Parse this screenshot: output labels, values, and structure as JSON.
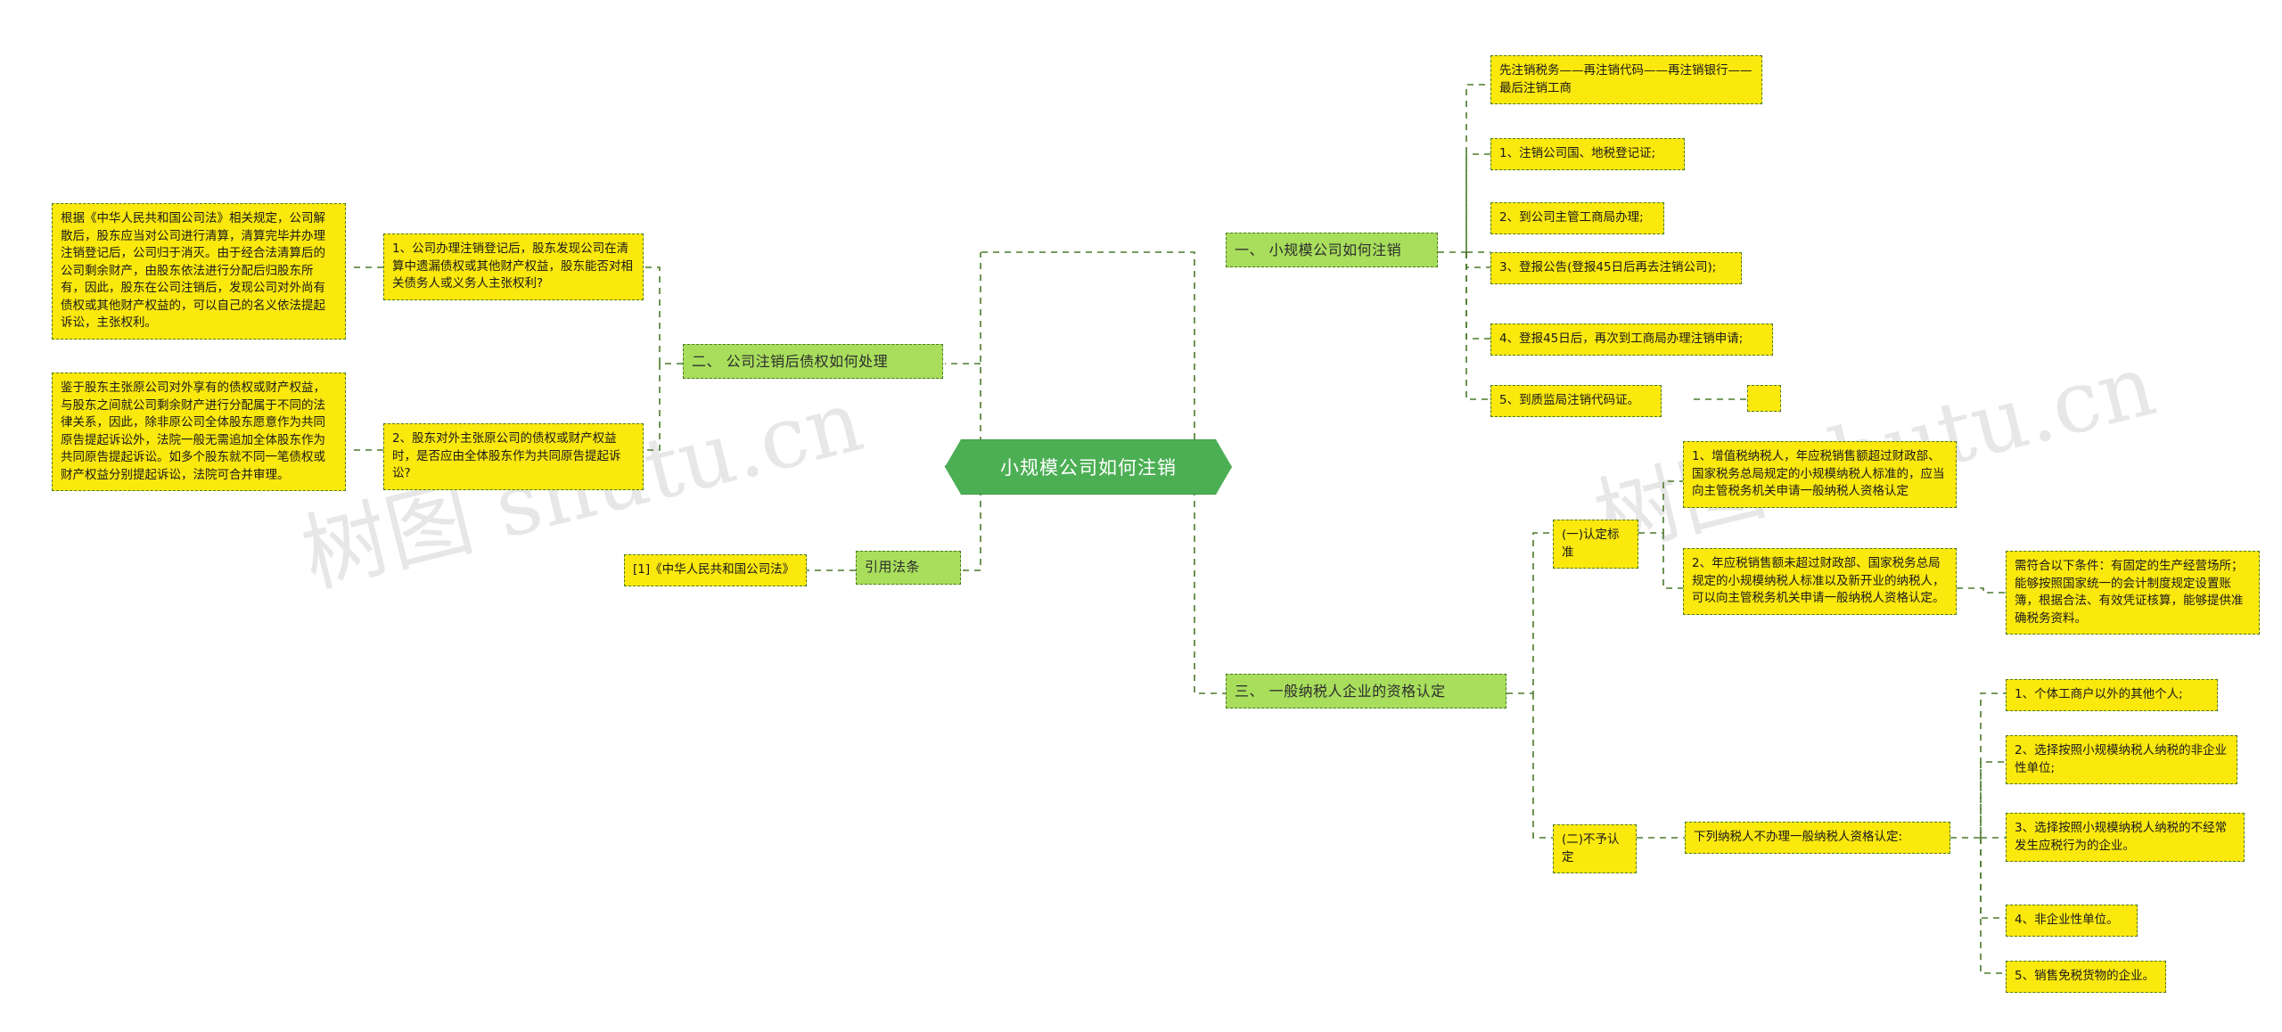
{
  "meta": {
    "title": "小规模公司如何注销",
    "watermarks": [
      "树图 shutu.cn",
      "树图 shutu.cn"
    ],
    "colors": {
      "center_fill": "#4caf54",
      "branch_fill": "#a8de5c",
      "leaf_fill": "#fbe80d",
      "border": "#4a7a28",
      "center_text": "#ffffff"
    }
  },
  "center": {
    "label": "小规模公司如何注销"
  },
  "branches": {
    "one": {
      "label": "一、 小规模公司如何注销"
    },
    "two": {
      "label": "二、 公司注销后债权如何处理"
    },
    "three": {
      "label": "三、 一般纳税人企业的资格认定"
    },
    "law": {
      "label": "引用法条"
    },
    "standard": {
      "label": "(一)认定标准"
    },
    "refuse": {
      "label": "(二)不予认定"
    }
  },
  "branch_one_items": [
    {
      "text": "先注销税务——再注销代码——再注销银行——最后注销工商"
    },
    {
      "text": "1、注销公司国、地税登记证;"
    },
    {
      "text": "2、到公司主管工商局办理;"
    },
    {
      "text": "3、登报公告(登报45日后再去注销公司);"
    },
    {
      "text": "4、登报45日后，再次到工商局办理注销申请;"
    },
    {
      "text": "5、到质监局注销代码证。"
    }
  ],
  "branch_two_items": [
    {
      "question": "1、公司办理注销登记后，股东发现公司在清算中遗漏债权或其他财产权益，股东能否对相关债务人或义务人主张权利?",
      "answer": "根据《中华人民共和国公司法》相关规定，公司解散后，股东应当对公司进行清算，清算完毕并办理注销登记后，公司归于消灭。由于经合法清算后的公司剩余财产，由股东依法进行分配后归股东所有，因此，股东在公司注销后，发现公司对外尚有债权或其他财产权益的，可以自己的名义依法提起诉讼，主张权利。"
    },
    {
      "question": "2、股东对外主张原公司的债权或财产权益时，是否应由全体股东作为共同原告提起诉讼?",
      "answer": "鉴于股东主张原公司对外享有的债权或财产权益，与股东之间就公司剩余财产进行分配属于不同的法律关系，因此，除非原公司全体股东愿意作为共同原告提起诉讼外，法院一般无需追加全体股东作为共同原告提起诉讼。如多个股东就不同一笔债权或财产权益分别提起诉讼，法院可合并审理。"
    }
  ],
  "law_items": [
    {
      "text": "[1]《中华人民共和国公司法》"
    }
  ],
  "standard_items": [
    {
      "text": "1、增值税纳税人，年应税销售额超过财政部、国家税务总局规定的小规模纳税人标准的，应当向主管税务机关申请一般纳税人资格认定"
    },
    {
      "text": "2、年应税销售额未超过财政部、国家税务总局规定的小规模纳税人标准以及新开业的纳税人，可以向主管税务机关申请一般纳税人资格认定。"
    }
  ],
  "standard_detail": {
    "text": "需符合以下条件：有固定的生产经营场所；能够按照国家统一的会计制度规定设置账簿，根据合法、有效凭证核算，能够提供准确税务资料。"
  },
  "refuse_header": {
    "text": "下列纳税人不办理一般纳税人资格认定:"
  },
  "refuse_items": [
    {
      "text": "1、个体工商户以外的其他个人;"
    },
    {
      "text": "2、选择按照小规模纳税人纳税的非企业性单位;"
    },
    {
      "text": "3、选择按照小规模纳税人纳税的不经常发生应税行为的企业。"
    },
    {
      "text": "4、非企业性单位。"
    },
    {
      "text": "5、销售免税货物的企业。"
    }
  ]
}
